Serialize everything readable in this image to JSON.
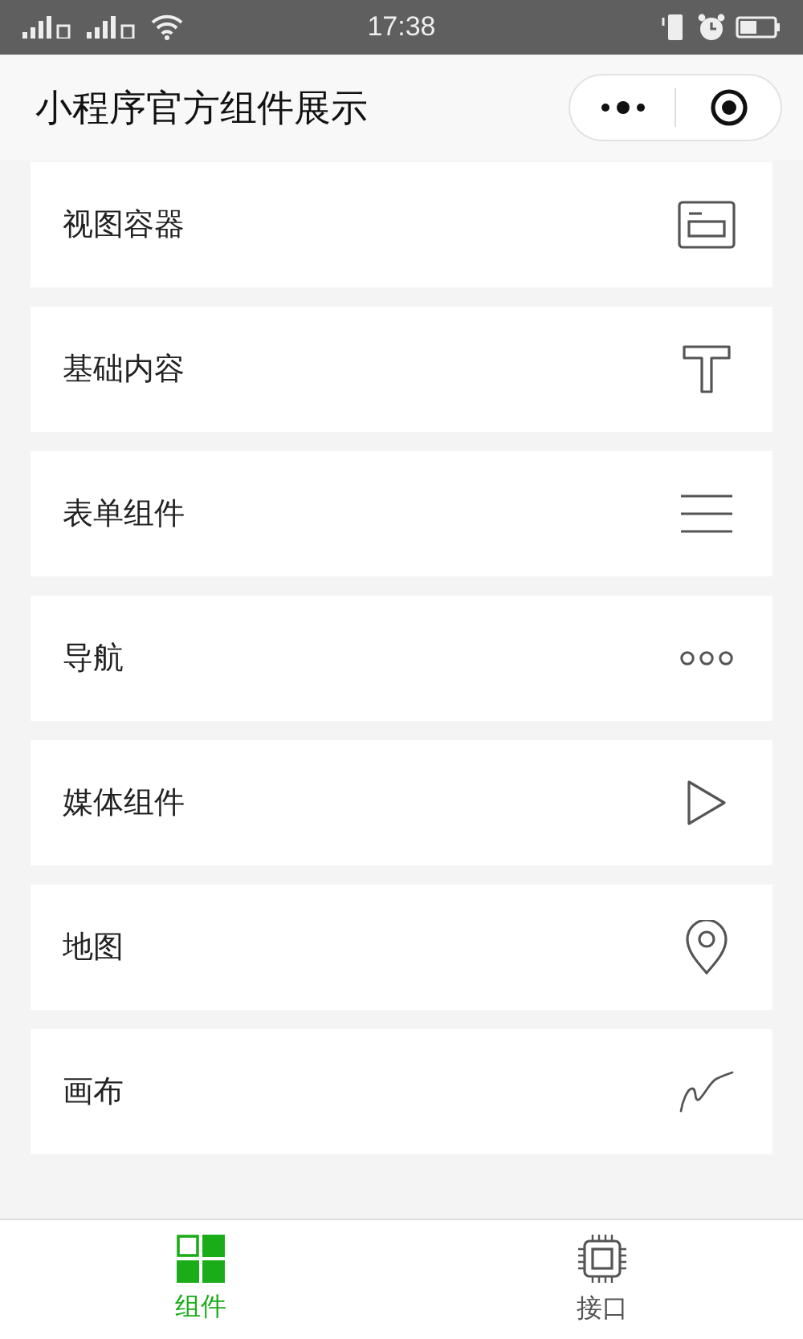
{
  "status_bar": {
    "time": "17:38"
  },
  "nav_bar": {
    "title": "小程序官方组件展示"
  },
  "items": [
    {
      "label": "视图容器",
      "kind": "view"
    },
    {
      "label": "基础内容",
      "kind": "text"
    },
    {
      "label": "表单组件",
      "kind": "form"
    },
    {
      "label": "导航",
      "kind": "nav"
    },
    {
      "label": "媒体组件",
      "kind": "media"
    },
    {
      "label": "地图",
      "kind": "map"
    },
    {
      "label": "画布",
      "kind": "canvas"
    }
  ],
  "tab_bar": [
    {
      "label": "组件",
      "kind": "grid",
      "selected": true
    },
    {
      "label": "接口",
      "kind": "chip",
      "selected": false
    }
  ]
}
